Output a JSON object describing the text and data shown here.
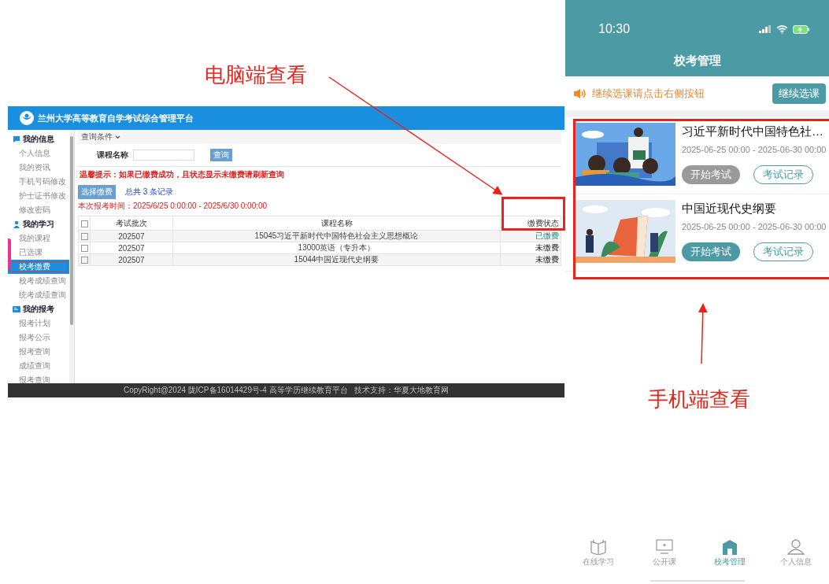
{
  "annotations": {
    "desktop_label": "电脑端查看",
    "mobile_label": "手机端查看"
  },
  "desktop": {
    "title": "兰州大学高等教育自学考试综合管理平台",
    "sidebar": [
      {
        "title": "我的信息",
        "items": [
          {
            "label": "个人信息",
            "selected": false
          },
          {
            "label": "我的资讯",
            "selected": false
          },
          {
            "label": "手机号码修改",
            "selected": false
          },
          {
            "label": "护士证书修改",
            "selected": false
          },
          {
            "label": "修改密码",
            "selected": false
          }
        ]
      },
      {
        "title": "我的学习",
        "items": [
          {
            "label": "我的课程",
            "selected": false
          },
          {
            "label": "已选课",
            "selected": false
          },
          {
            "label": "校考缴费",
            "selected": true
          },
          {
            "label": "校考成绩查询",
            "selected": false
          },
          {
            "label": "统考成绩查询",
            "selected": false
          }
        ]
      },
      {
        "title": "我的报考",
        "items": [
          {
            "label": "报考计划",
            "selected": false
          },
          {
            "label": "报考公示",
            "selected": false
          },
          {
            "label": "报考查询",
            "selected": false
          },
          {
            "label": "成绩查询",
            "selected": false
          },
          {
            "label": "报考查询",
            "selected": false
          }
        ]
      }
    ],
    "filter_label": "查询条件",
    "field_label": "课程名称",
    "search_button": "查询",
    "notice": "温馨提示：如果已缴费成功，且状态显示未缴费请刷新查询",
    "pay_button": "选择缴费",
    "record_count": "总共 3 条记录",
    "period": "本次报考时间：2025/6/25 0:00:00 - 2025/6/30 0:00:00",
    "table": {
      "header_checked": false,
      "columns": [
        "考试批次",
        "课程名称",
        "缴费状态"
      ],
      "rows": [
        {
          "checked": false,
          "batch": "202507",
          "course": "15045习近平新时代中国特色社会主义思想概论",
          "status": "已缴费",
          "paid": true
        },
        {
          "checked": false,
          "batch": "202507",
          "course": "13000英语（专升本）",
          "status": "未缴费",
          "paid": false
        },
        {
          "checked": false,
          "batch": "202507",
          "course": "15044中国近现代史纲要",
          "status": "未缴费",
          "paid": false
        }
      ]
    },
    "footer": "CopyRight@2024 陇ICP备16014429号-4 高等学历继续教育平台   技术支持：华夏大地教育网"
  },
  "mobile": {
    "time": "10:30",
    "title": "校考管理",
    "notice": "继续选课请点击右侧按钮",
    "notice_button": "继续选课",
    "courses": [
      {
        "title": "习近平新时代中国特色社…",
        "period": "2025-06-25 00:00 - 2025-06-30 00:00",
        "start_button": "开始考试",
        "start_disabled": true,
        "record_button": "考试记录"
      },
      {
        "title": "中国近现代史纲要",
        "period": "2025-06-25 00:00 - 2025-06-30 00:00",
        "start_button": "开始考试",
        "start_disabled": false,
        "record_button": "考试记录"
      }
    ],
    "tabs": [
      {
        "label": "在线学习",
        "selected": false
      },
      {
        "label": "公开课",
        "selected": false
      },
      {
        "label": "校考管理",
        "selected": true
      },
      {
        "label": "个人信息",
        "selected": false
      }
    ]
  }
}
